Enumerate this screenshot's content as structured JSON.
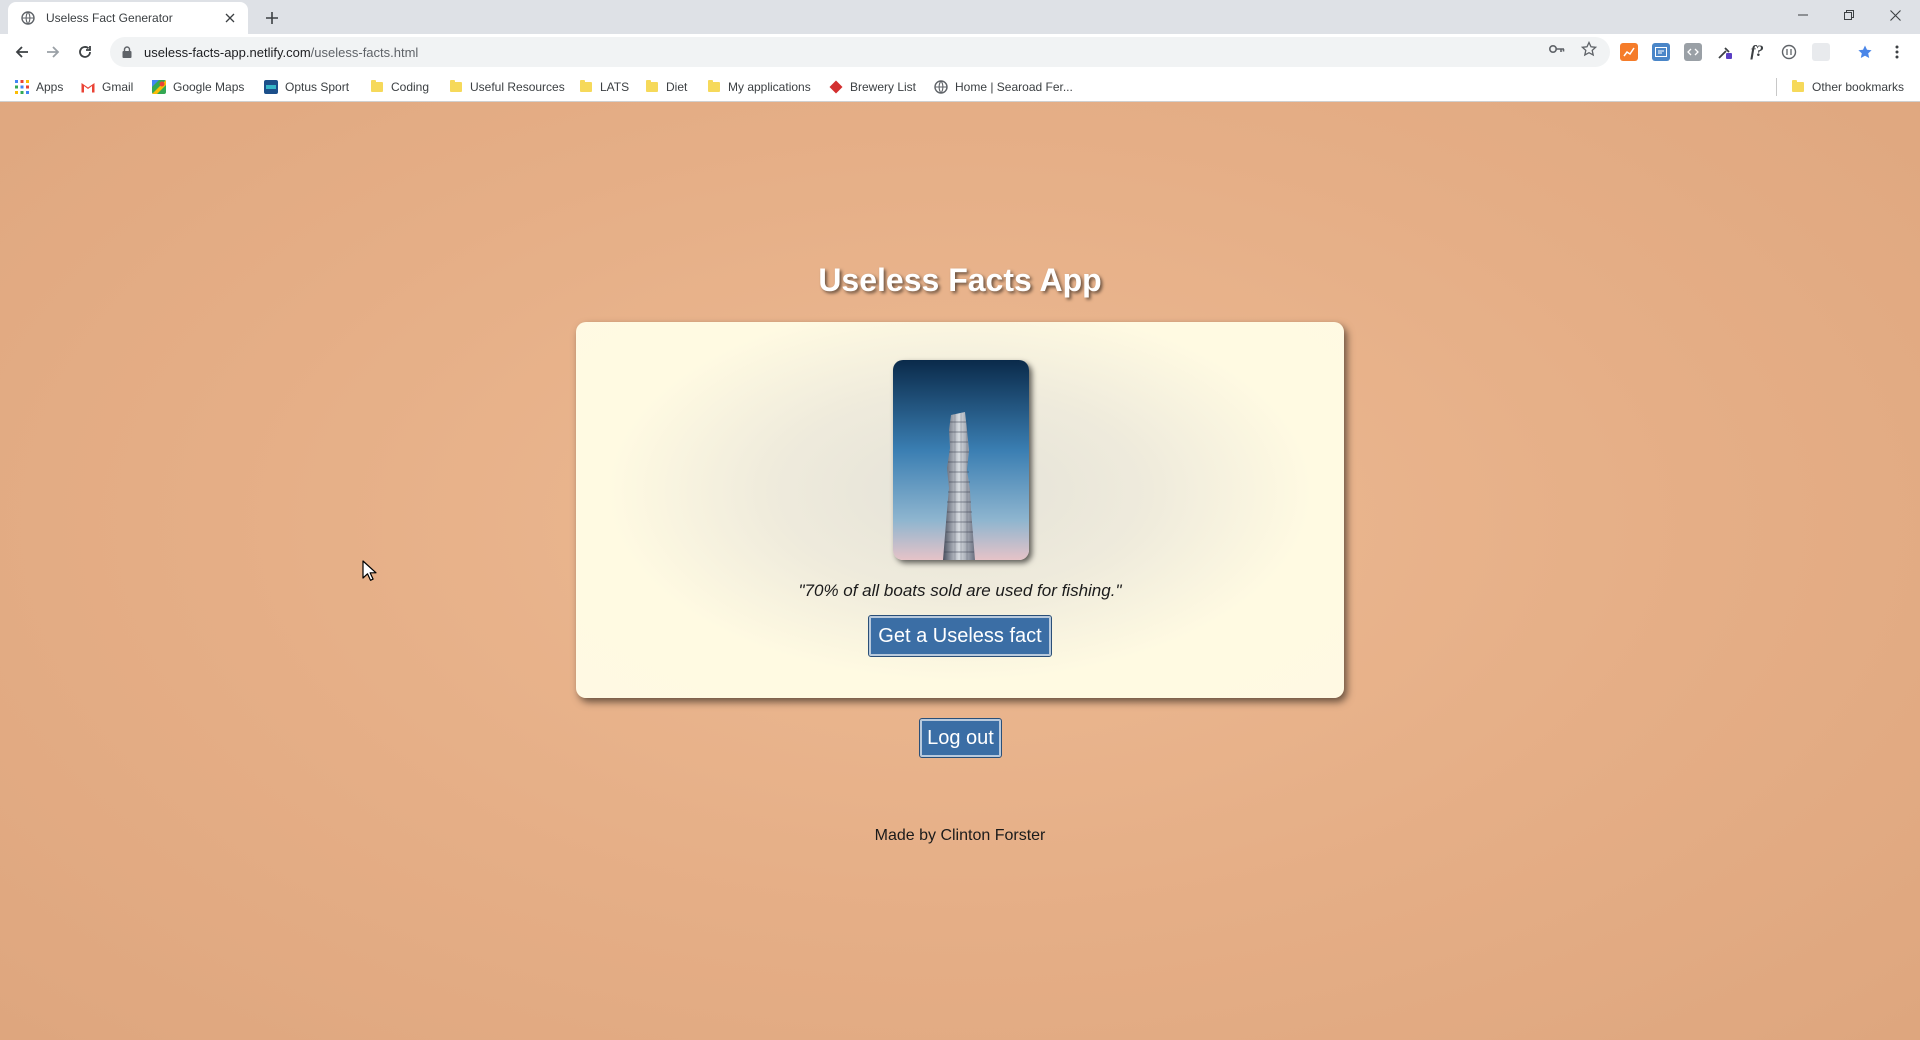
{
  "browser": {
    "tab": {
      "title": "Useless Fact Generator"
    },
    "url": {
      "host": "useless-facts-app.netlify.com",
      "path": "/useless-facts.html"
    },
    "bookmarks": [
      {
        "label": "Apps",
        "icon": "apps-grid-icon"
      },
      {
        "label": "Gmail",
        "icon": "gmail-icon"
      },
      {
        "label": "Google Maps",
        "icon": "google-maps-icon"
      },
      {
        "label": "Optus Sport",
        "icon": "optus-sport-icon"
      },
      {
        "label": "Coding",
        "icon": "folder-icon"
      },
      {
        "label": "Useful Resources",
        "icon": "folder-icon"
      },
      {
        "label": "LATS",
        "icon": "folder-icon"
      },
      {
        "label": "Diet",
        "icon": "folder-icon"
      },
      {
        "label": "My applications",
        "icon": "folder-icon"
      },
      {
        "label": "Brewery List",
        "icon": "brewery-icon"
      },
      {
        "label": "Home | Searoad Fer...",
        "icon": "globe-icon"
      }
    ],
    "other_bookmarks": "Other bookmarks"
  },
  "app": {
    "title": "Useless Facts App",
    "fact": "\"70% of all boats sold are used for fishing.\"",
    "fact_button": "Get a Useless fact",
    "logout_button": "Log out",
    "credit": "Made by Clinton Forster"
  },
  "colors": {
    "page_background": "#e2ab84",
    "card_background": "#fff9e3",
    "button": "#3b6ea5"
  }
}
